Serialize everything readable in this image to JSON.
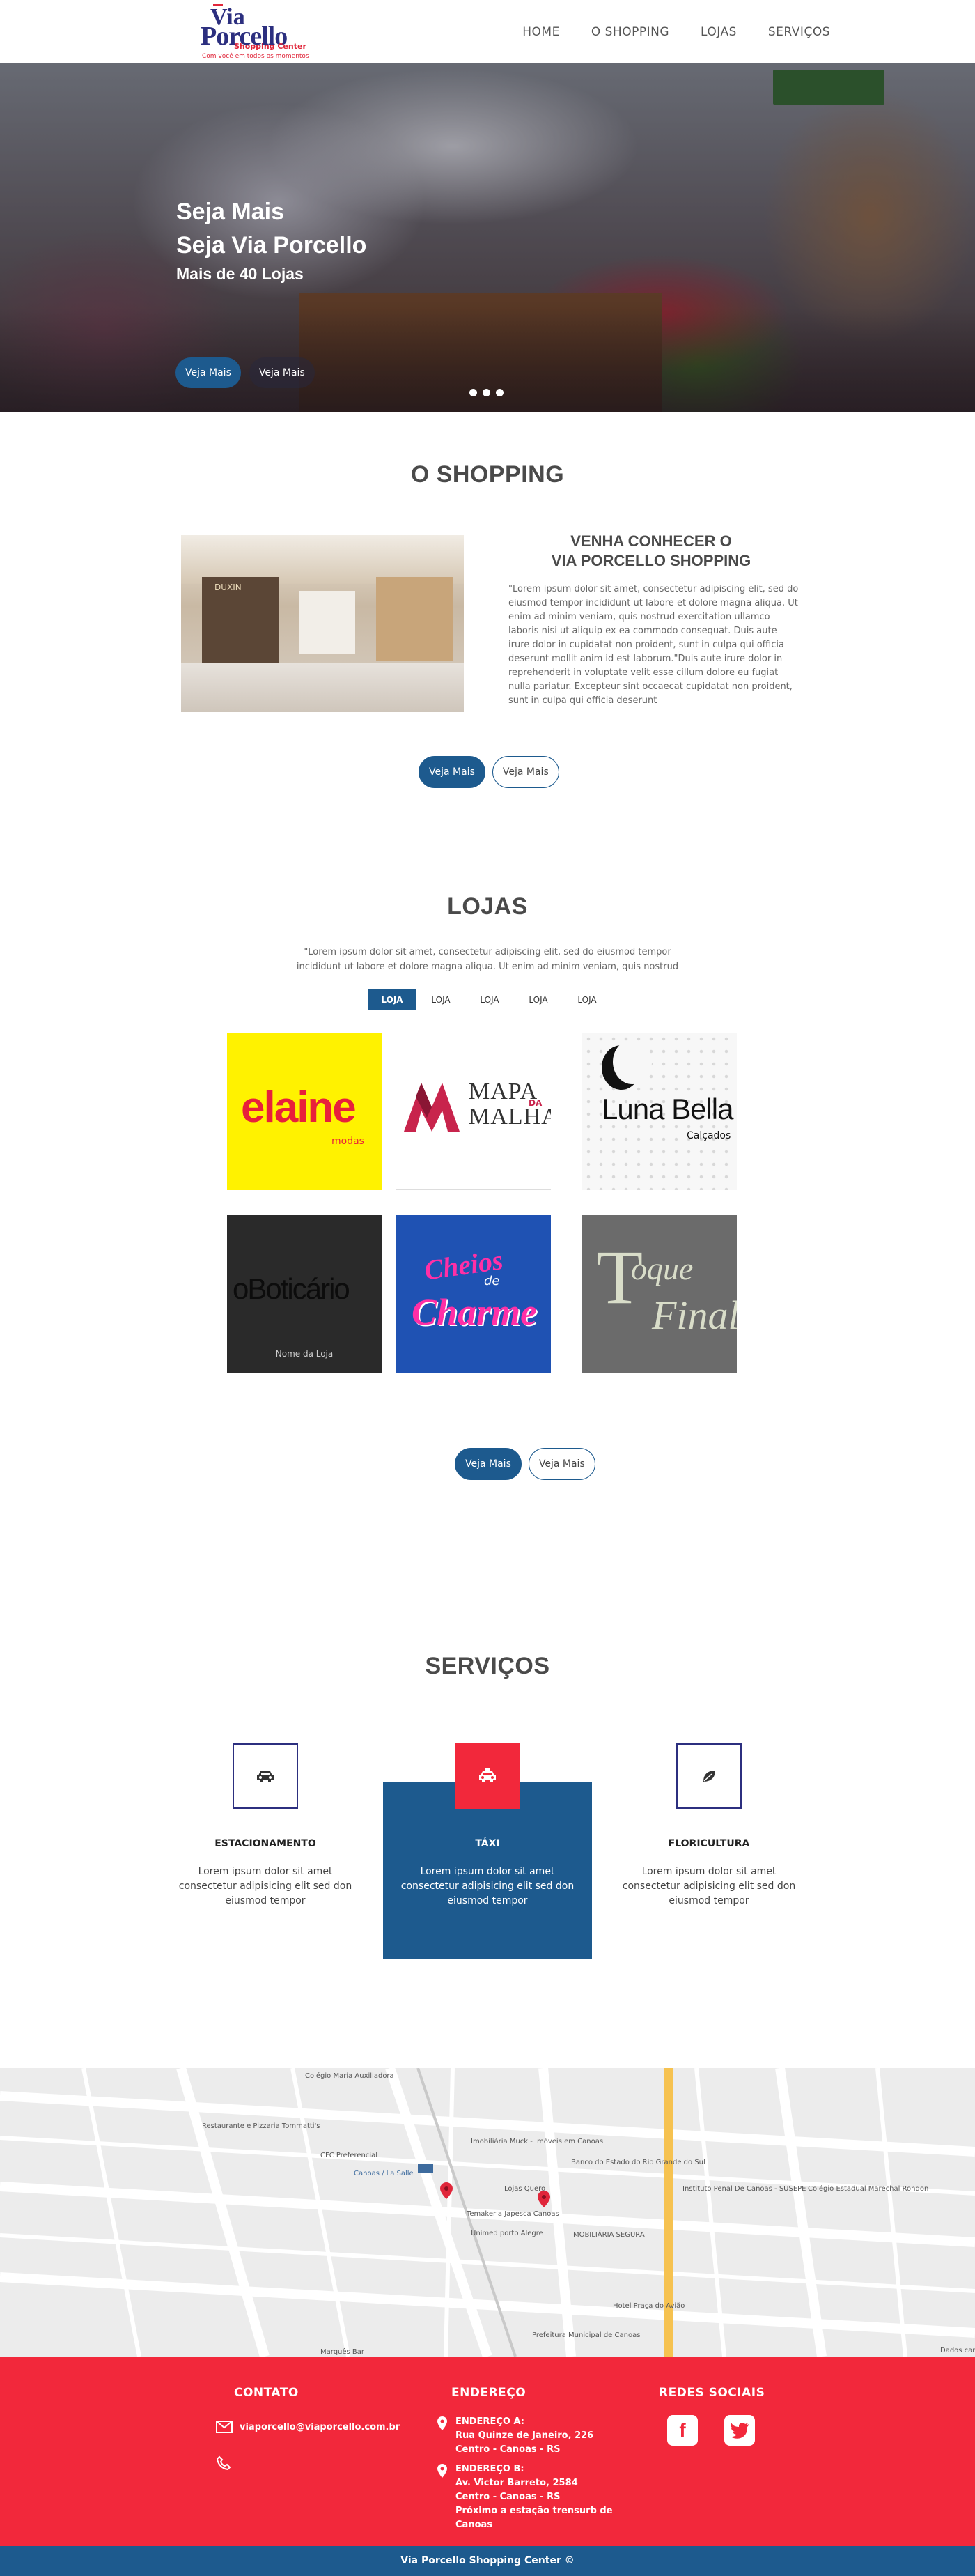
{
  "brand": {
    "logo_line1": "Via",
    "logo_line2": "Porcello",
    "logo_line3": "Shopping Center",
    "logo_tagline": "Com você em todos os momentos"
  },
  "nav": {
    "items": [
      {
        "label": "HOME"
      },
      {
        "label": "O SHOPPING"
      },
      {
        "label": "LOJAS"
      },
      {
        "label": "SERVIÇOS"
      }
    ]
  },
  "hero": {
    "line1": "Seja Mais",
    "line2": "Seja Via Porcello",
    "line3": "Mais de 40 Lojas",
    "btn_primary": "Veja Mais",
    "btn_secondary": "Veja Mais",
    "slides": 3
  },
  "shopping": {
    "title": "O SHOPPING",
    "heading_line1": "VENHA CONHECER O",
    "heading_line2": "VIA PORCELLO SHOPPING",
    "paragraph": "\"Lorem ipsum dolor sit amet, consectetur adipiscing elit, sed do eiusmod tempor incididunt ut labore et dolore magna aliqua. Ut enim ad minim veniam, quis nostrud exercitation ullamco laboris nisi ut aliquip ex ea commodo consequat. Duis aute irure dolor in cupidatat non proident, sunt in culpa qui officia deserunt mollit anim id est laborum.\"Duis aute irure dolor in reprehenderit in voluptate velit esse cillum dolore eu fugiat nulla pariatur. Excepteur sint occaecat cupidatat non proident, sunt in culpa qui officia deserunt",
    "image_sign": "DUXIN",
    "btn_primary": "Veja Mais",
    "btn_outline": "Veja Mais"
  },
  "lojas": {
    "title": "LOJAS",
    "paragraph_line1": "\"Lorem ipsum dolor sit amet, consectetur adipiscing elit, sed do eiusmod tempor",
    "paragraph_line2": "incididunt ut labore et dolore magna aliqua. Ut enim ad minim veniam, quis nostrud",
    "tabs": [
      "LOJA",
      "LOJA",
      "LOJA",
      "LOJA",
      "LOJA"
    ],
    "stores": {
      "elaine": {
        "name": "elaine",
        "sub": "modas"
      },
      "mapa": {
        "w1": "MAPA",
        "da": "DA",
        "w2": "MALHA"
      },
      "luna": {
        "name": "Luna Bella",
        "sub": "Calçados"
      },
      "boticario": {
        "name": "oBoticário",
        "caption": "Nome da Loja"
      },
      "cheios": {
        "n1": "Cheios",
        "de": "de",
        "n2": "Charme"
      },
      "toque": {
        "T": "T",
        "n1": "oque",
        "n2": "Final"
      }
    },
    "btn_primary": "Veja Mais",
    "btn_outline": "Veja Mais"
  },
  "servicos": {
    "title": "SERVIÇOS",
    "items": [
      {
        "title": "ESTACIONAMENTO",
        "desc": "Lorem ipsum dolor sit amet consectetur adipisicing elit sed don eiusmod tempor",
        "icon": "car-icon"
      },
      {
        "title": "TÁXI",
        "desc": "Lorem ipsum dolor sit amet consectetur adipisicing elit sed don eiusmod tempor",
        "icon": "taxi-icon"
      },
      {
        "title": "FLORICULTURA",
        "desc": "Lorem ipsum dolor sit amet consectetur adipisicing elit sed don eiusmod tempor",
        "icon": "leaf-icon"
      }
    ],
    "accent_color": "#1d5a8e",
    "highlight_color": "#f2283b"
  },
  "map": {
    "labels": {
      "a": "Colégio Maria Auxiliadora",
      "b": "Restaurante e Pizzaria Tommatti's",
      "c": "CFC Preferencial",
      "d": "Canoas / La Salle",
      "e": "Imobiliária Muck - Imóveis em Canoas",
      "f": "Banco do Estado do Rio Grande do Sul",
      "g": "Lojas Quero",
      "h": "Temakeria Japesca Canoas",
      "i": "Unimed porto Alegre",
      "j": "IMOBILIÁRIA SEGURA",
      "k": "Instituto Penal De Canoas - SUSEPE",
      "l": "Colégio Estadual Marechal Rondon",
      "m": "Hotel Praça do Avião",
      "n": "Prefeitura Municipal de Canoas",
      "o": "Marquês Bar",
      "p": "Dados carto"
    }
  },
  "footer": {
    "contato_title": "CONTATO",
    "email": "viaporcello@viaporcello.com.br",
    "endereco_title": "ENDEREÇO",
    "addr_a": [
      "ENDEREÇO A:",
      "Rua Quinze de Janeiro, 226",
      "Centro - Canoas - RS"
    ],
    "addr_b": [
      "ENDEREÇO B:",
      "Av. Victor Barreto, 2584",
      "Centro - Canoas - RS",
      "Próximo a estação trensurb de",
      "Canoas"
    ],
    "redes_title": "REDES SOCIAIS",
    "copyright": "Via Porcello Shopping Center ©"
  }
}
